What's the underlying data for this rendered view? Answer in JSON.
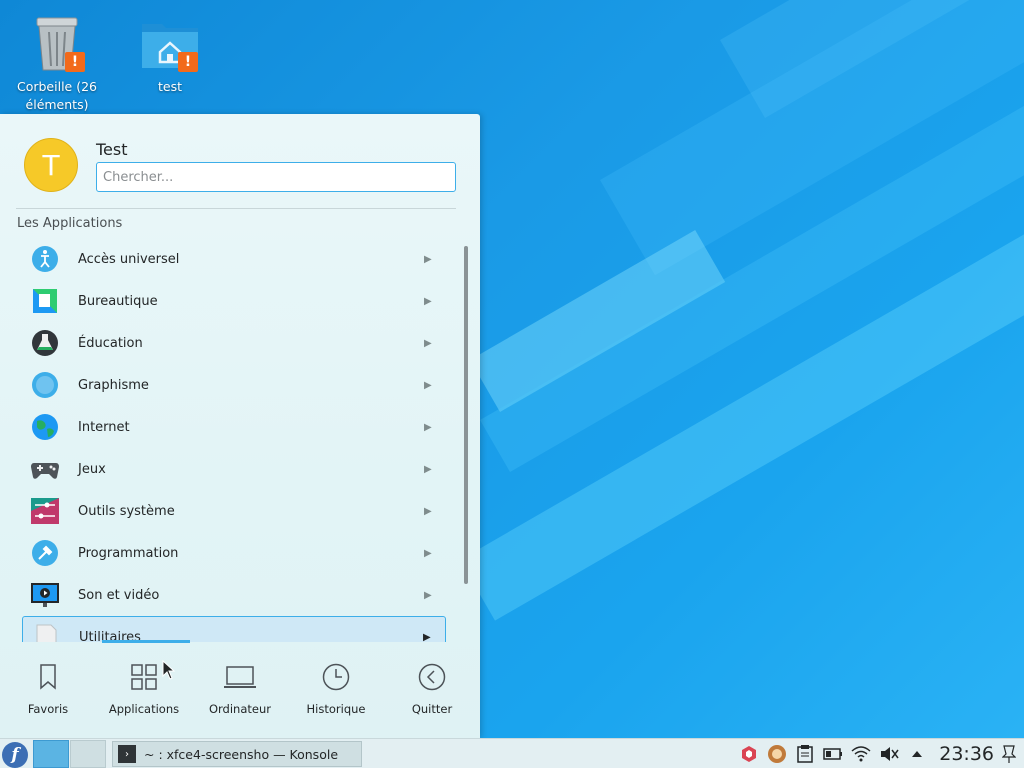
{
  "desktop": {
    "icons": [
      {
        "label": "Corbeille (26 éléments)",
        "icon": "trash-icon"
      },
      {
        "label": "test",
        "icon": "home-folder-icon"
      }
    ],
    "warning_glyph": "!"
  },
  "launcher": {
    "user_initial": "T",
    "user_name": "Test",
    "search_placeholder": "Chercher...",
    "section_title": "Les Applications",
    "categories": [
      {
        "label": "Accès universel",
        "icon": "accessibility-icon"
      },
      {
        "label": "Bureautique",
        "icon": "office-icon"
      },
      {
        "label": "Éducation",
        "icon": "education-icon"
      },
      {
        "label": "Graphisme",
        "icon": "graphics-icon"
      },
      {
        "label": "Internet",
        "icon": "internet-globe-icon"
      },
      {
        "label": "Jeux",
        "icon": "gamepad-icon"
      },
      {
        "label": "Outils système",
        "icon": "system-tools-icon"
      },
      {
        "label": "Programmation",
        "icon": "development-icon"
      },
      {
        "label": "Son et vidéo",
        "icon": "multimedia-icon"
      },
      {
        "label": "Utilitaires",
        "icon": "utilities-icon",
        "selected": true
      }
    ],
    "tabs": [
      {
        "label": "Favoris",
        "icon": "bookmark-icon"
      },
      {
        "label": "Applications",
        "icon": "apps-grid-icon"
      },
      {
        "label": "Ordinateur",
        "icon": "laptop-icon"
      },
      {
        "label": "Historique",
        "icon": "clock-icon"
      },
      {
        "label": "Quitter",
        "icon": "back-circle-icon"
      }
    ]
  },
  "taskbar": {
    "launcher_glyph": "f",
    "task_label": "~ : xfce4-screensho — Konsole",
    "task_glyph": "›",
    "clock": "23:36"
  },
  "colors": {
    "accent": "#3daee9",
    "warning": "#f26a1b",
    "avatar": "#f6c928"
  }
}
